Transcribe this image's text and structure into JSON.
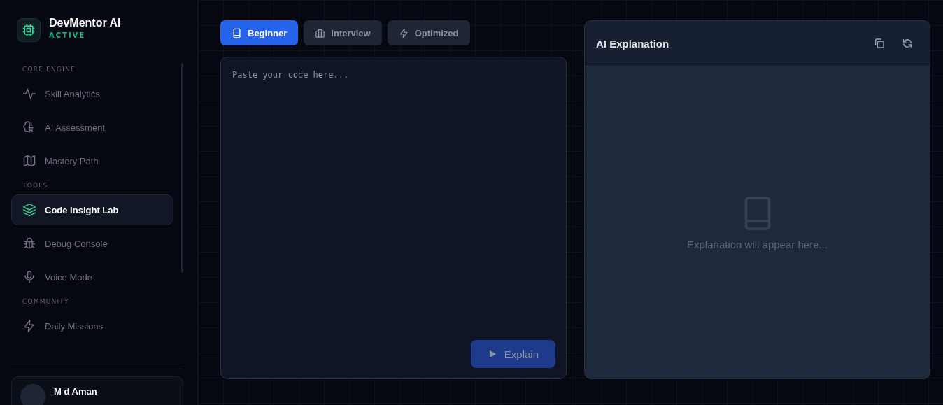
{
  "brand": {
    "name": "DevMentor AI",
    "status": "ACTIVE"
  },
  "sidebar": {
    "sections": [
      {
        "title": "CORE ENGINE",
        "items": [
          {
            "label": "Skill Analytics",
            "selected": false
          },
          {
            "label": "AI Assessment",
            "selected": false
          },
          {
            "label": "Mastery Path",
            "selected": false
          }
        ]
      },
      {
        "title": "TOOLS",
        "items": [
          {
            "label": "Code Insight Lab",
            "selected": true
          },
          {
            "label": "Debug Console",
            "selected": false
          },
          {
            "label": "Voice Mode",
            "selected": false
          }
        ]
      },
      {
        "title": "COMMUNITY",
        "items": [
          {
            "label": "Daily Missions",
            "selected": false
          }
        ]
      }
    ],
    "user": {
      "name": "M d Aman"
    }
  },
  "tabs": [
    {
      "label": "Beginner",
      "selected": true
    },
    {
      "label": "Interview",
      "selected": false
    },
    {
      "label": "Optimized",
      "selected": false
    }
  ],
  "editor": {
    "placeholder": "Paste your code here...",
    "button": {
      "label": "Explain",
      "disabled": true
    }
  },
  "explanation": {
    "title": "AI Explanation",
    "empty_text": "Explanation will appear here..."
  }
}
